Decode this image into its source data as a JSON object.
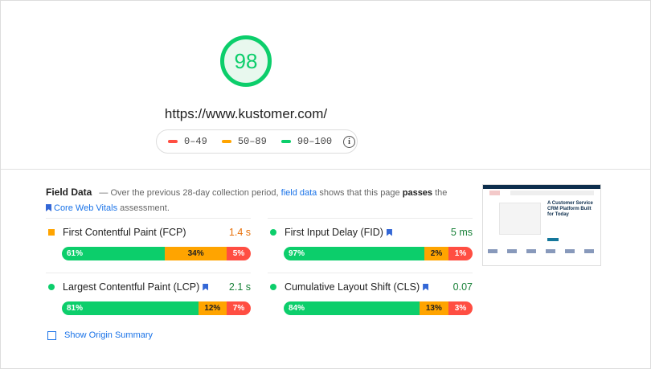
{
  "score": "98",
  "url": "https://www.kustomer.com/",
  "legend": [
    {
      "label": "0–49",
      "color": "#ff4e42"
    },
    {
      "label": "50–89",
      "color": "#ffa400"
    },
    {
      "label": "90–100",
      "color": "#0cce6b"
    }
  ],
  "field_data": {
    "title": "Field Data",
    "desc_pre": "— Over the previous 28-day collection period,",
    "link": "field data",
    "desc_mid": "shows that this page",
    "status": "passes",
    "desc_post": "the",
    "cwv_link": "Core Web Vitals",
    "desc_end": "assessment."
  },
  "metrics": [
    {
      "name": "First Contentful Paint (FCP)",
      "value": "1.4 s",
      "value_color": "#e8710a",
      "indicator": "square-orange",
      "bar": [
        "61%",
        "34%",
        "5%"
      ],
      "cwv": false
    },
    {
      "name": "First Input Delay (FID)",
      "value": "5 ms",
      "value_color": "#188038",
      "indicator": "circle-green",
      "bar": [
        "97%",
        "2%",
        "1%"
      ],
      "cwv": true
    },
    {
      "name": "Largest Contentful Paint (LCP)",
      "value": "2.1 s",
      "value_color": "#188038",
      "indicator": "circle-green",
      "bar": [
        "81%",
        "12%",
        "7%"
      ],
      "cwv": true
    },
    {
      "name": "Cumulative Layout Shift (CLS)",
      "value": "0.07",
      "value_color": "#188038",
      "indicator": "circle-green",
      "bar": [
        "84%",
        "13%",
        "3%"
      ],
      "cwv": true
    }
  ],
  "show_origin": "Show Origin Summary",
  "thumbnail": {
    "headline": "A Customer Service CRM Platform Built for Today"
  }
}
